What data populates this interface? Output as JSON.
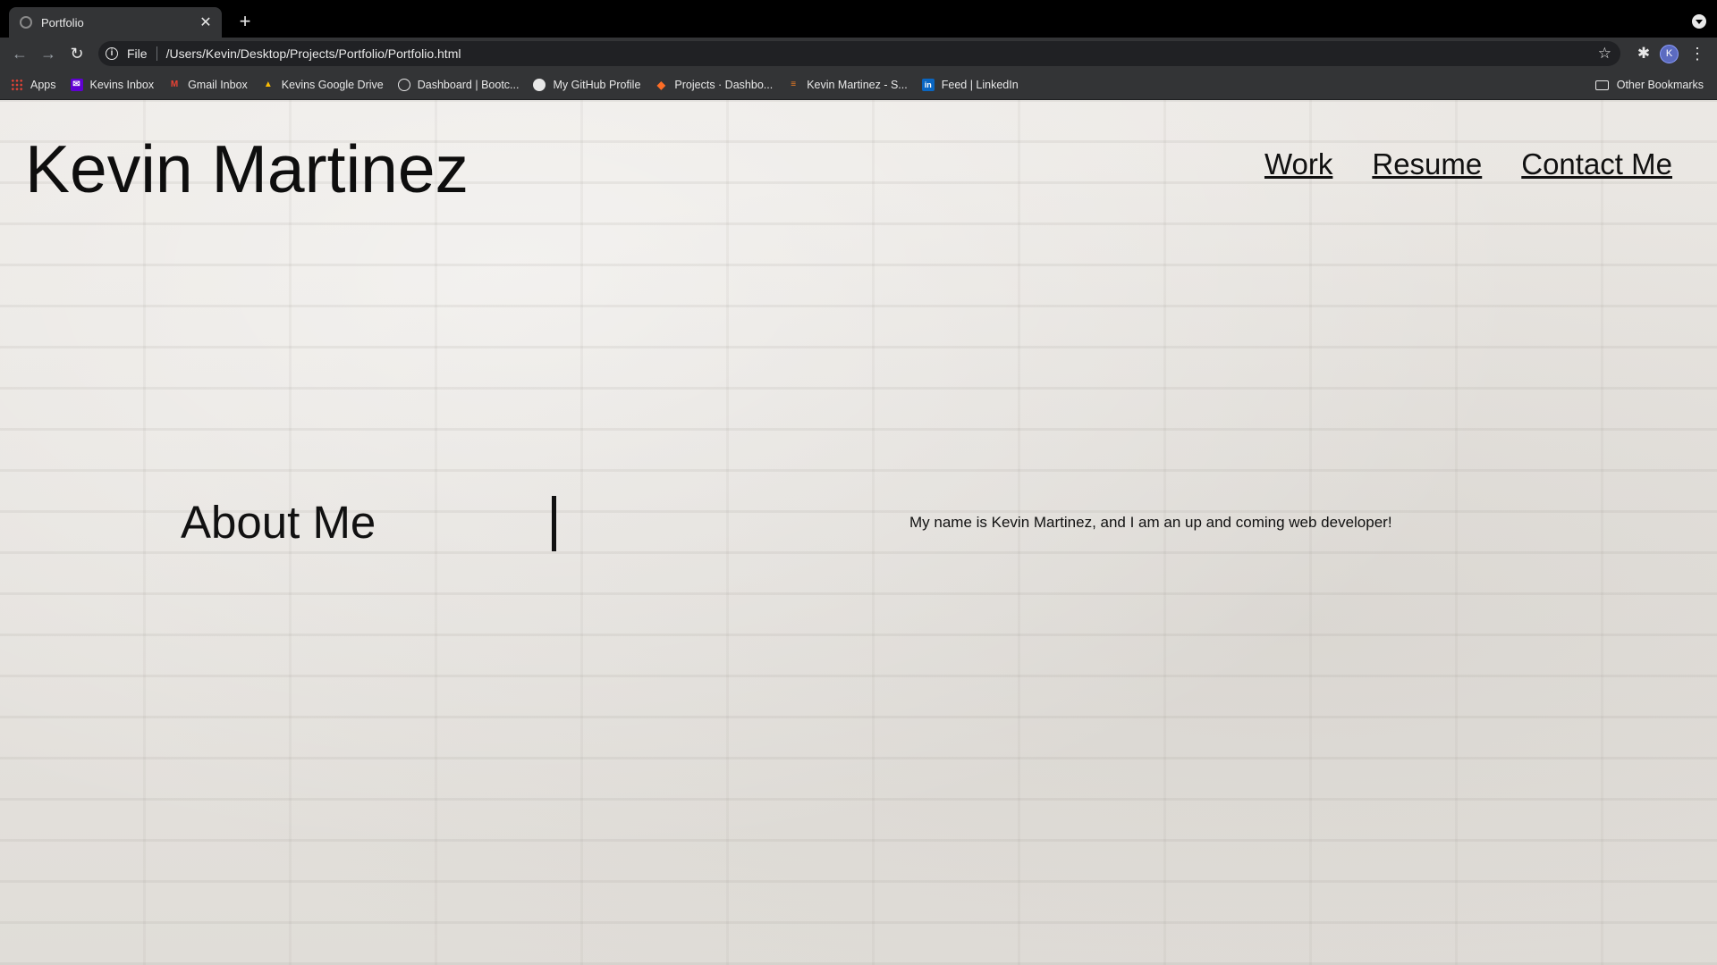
{
  "browser": {
    "tab": {
      "title": "Portfolio",
      "close_glyph": "✕"
    },
    "new_tab_glyph": "+",
    "nav": {
      "back_glyph": "←",
      "forward_glyph": "→",
      "reload_glyph": "↻"
    },
    "address": {
      "scheme": "File",
      "url": "/Users/Kevin/Desktop/Projects/Portfolio/Portfolio.html"
    },
    "star_glyph": "☆",
    "extensions_glyph": "✱",
    "avatar_initial": "K",
    "menu_glyph": "⋮",
    "bookmarks": [
      {
        "label": "Apps",
        "icon": "apps-grid-icon",
        "color": "#ea4335"
      },
      {
        "label": "Kevins Inbox",
        "icon": "yahoo-mail-icon",
        "color": "#6001d2"
      },
      {
        "label": "Gmail Inbox",
        "icon": "gmail-icon",
        "color": "#ea4335"
      },
      {
        "label": "Kevins Google Drive",
        "icon": "google-drive-icon",
        "color": "#fbbc04"
      },
      {
        "label": "Dashboard | Bootc...",
        "icon": "globe-icon",
        "color": "#e8e8e8"
      },
      {
        "label": "My GitHub Profile",
        "icon": "github-icon",
        "color": "#e8e8e8"
      },
      {
        "label": "Projects · Dashbo...",
        "icon": "gitlab-icon",
        "color": "#fc6d26"
      },
      {
        "label": "Kevin Martinez - S...",
        "icon": "stackoverflow-icon",
        "color": "#f48024"
      },
      {
        "label": "Feed | LinkedIn",
        "icon": "linkedin-icon",
        "color": "#0a66c2"
      }
    ],
    "other_bookmarks": "Other Bookmarks"
  },
  "site": {
    "name": "Kevin Martinez",
    "nav": [
      "Work",
      "Resume",
      "Contact Me"
    ],
    "about": {
      "title": "About Me",
      "text": "My name is Kevin Martinez, and I am an up and coming web developer!"
    }
  }
}
